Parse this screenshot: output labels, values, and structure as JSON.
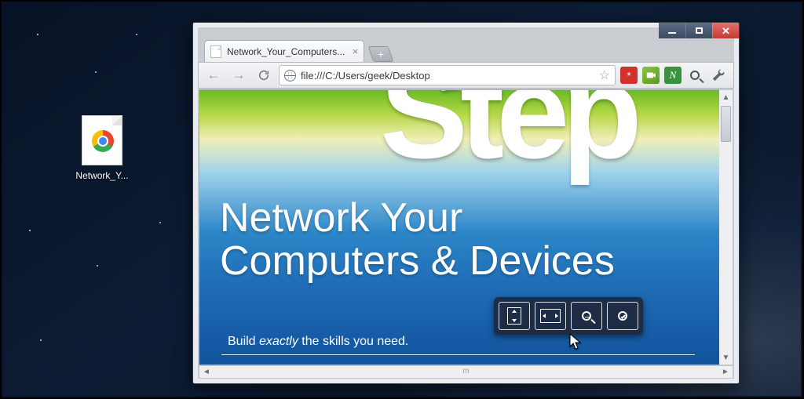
{
  "desktop": {
    "icon_label": "Network_Y..."
  },
  "window": {
    "tab_title": "Network_Your_Computers...",
    "url": "file:///C:/Users/geek/Desktop",
    "extensions": {
      "lastpass": "*",
      "evernote": "N"
    }
  },
  "document": {
    "banner_word": "Step",
    "title_line1": "Network Your",
    "title_line2": "Computers & Devices",
    "subtitle_prefix": "Build ",
    "subtitle_em": "exactly",
    "subtitle_suffix": " the skills you need."
  },
  "scroll": {
    "marker": "m"
  }
}
